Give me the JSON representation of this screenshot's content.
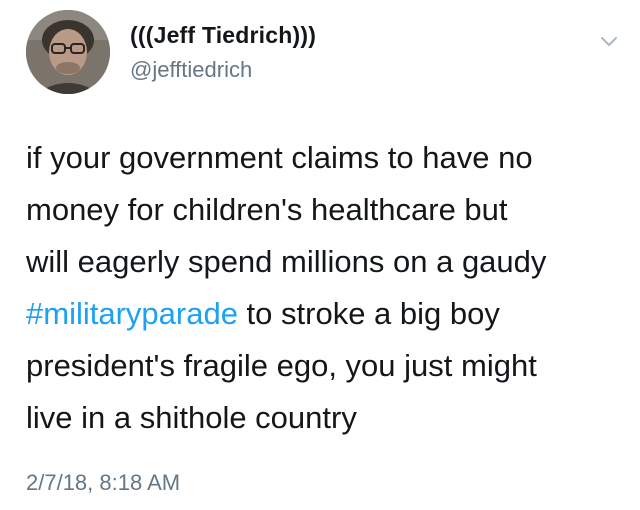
{
  "author": {
    "display_name": "(((Jeff Tiedrich)))",
    "handle": "@jefftiedrich"
  },
  "tweet": {
    "line_1": "if your government claims to have no",
    "line_2": "money for children's healthcare but",
    "line_3": "will eagerly spend millions on a gaudy",
    "hashtag": "#militaryparade",
    "line_4_rest": " to stroke a big boy",
    "line_5": "president's fragile ego, you just might",
    "line_6": "live in a shithole country"
  },
  "timestamp": "2/7/18, 8:18 AM",
  "colors": {
    "text": "#14171a",
    "secondary": "#657786",
    "link": "#1da1f2",
    "caret": "#aab8c2"
  },
  "icons": {
    "menu": "chevron-down-icon",
    "avatar": "profile-photo"
  }
}
